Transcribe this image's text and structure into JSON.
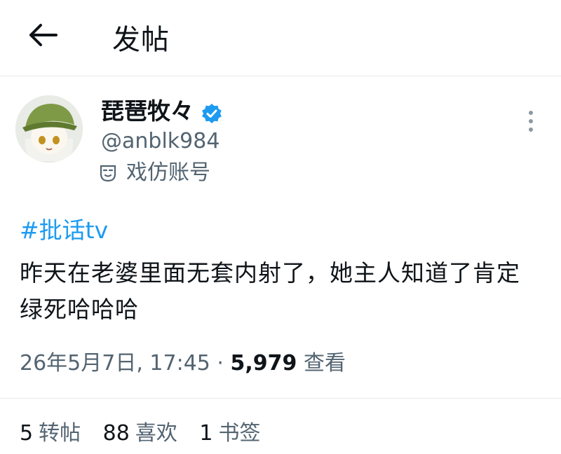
{
  "header": {
    "title": "发帖",
    "back_icon": "arrow-left-icon"
  },
  "author": {
    "display_name": "琵琶牧々",
    "verified_icon": "verified-badge-icon",
    "verified_color": "#1d9bf0",
    "handle": "@anblk984",
    "label_icon": "parody-mask-icon",
    "label": "戏仿账号"
  },
  "post": {
    "hashtag": "#批话tv",
    "text": "昨天在老婆里面无套内射了，她主人知道了肯定绿死哈哈哈",
    "timestamp": "26年5月7日, 17:45",
    "separator": "·",
    "views_count": "5,979",
    "views_label": "查看"
  },
  "stats": {
    "reposts_count": "5",
    "reposts_label": "转帖",
    "likes_count": "88",
    "likes_label": "喜欢",
    "bookmarks_count": "1",
    "bookmarks_label": "书签"
  },
  "colors": {
    "accent": "#1d9bf0",
    "secondary_text": "#536471",
    "primary_text": "#0f1419"
  }
}
